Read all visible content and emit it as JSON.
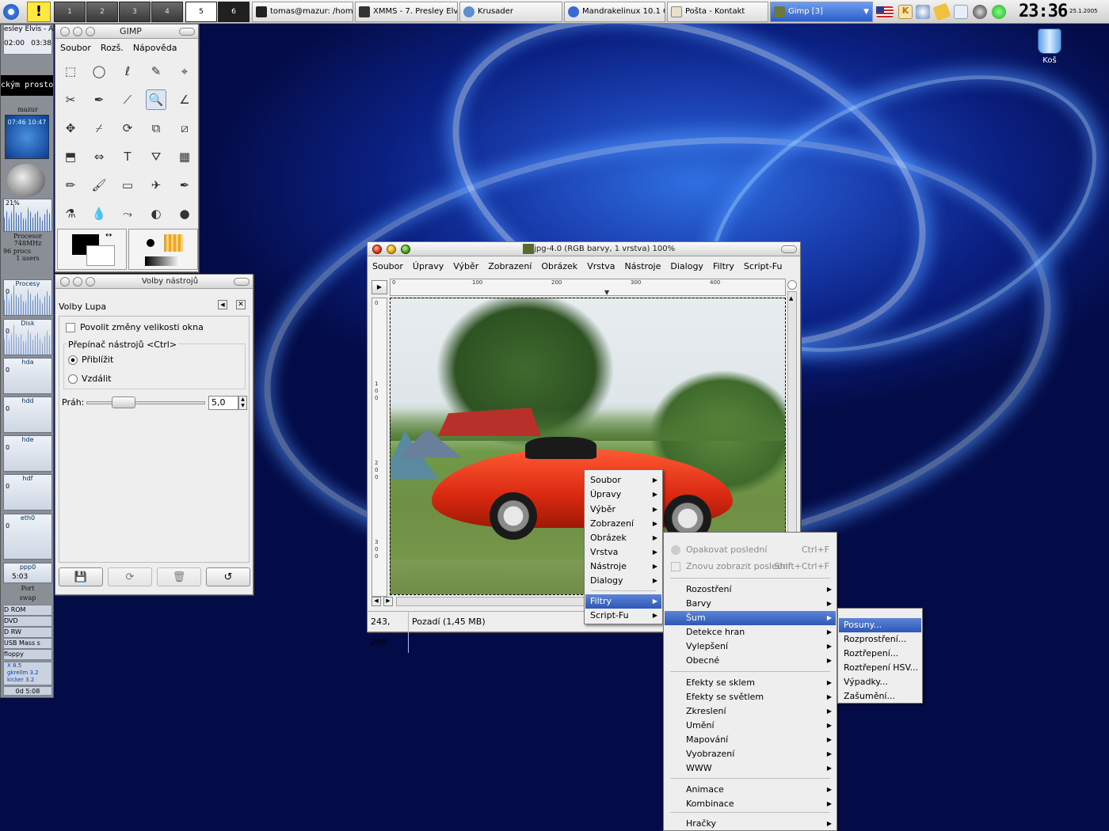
{
  "taskbar": {
    "pagers": [
      "1",
      "2",
      "3",
      "4",
      "5",
      "6"
    ],
    "tasks": [
      "tomas@mazur: /home",
      "XMMS - 7. Presley Elv",
      "Krusader",
      "Mandrakelinux 10.1 C",
      "Pošta - Kontakt",
      "Gimp [3]"
    ],
    "clock": "23:36",
    "date": "25.1.2005",
    "colors": {
      "active_task": "#2c5dc8",
      "desktop": "#0a1f80"
    }
  },
  "gkrellm": {
    "song": "esley Elvis - A",
    "time_start": "02:00",
    "time_end": "03:38",
    "marquee": "ckým prosto",
    "host": "mazur",
    "clock_face": "07:46 10:47",
    "cpu_pct": "21%",
    "cpu_label": "Procesor",
    "cpu_freq": "748MHz",
    "procs": "96 procs",
    "users": "1 users",
    "panels": [
      {
        "label": "Procesy",
        "value": "0"
      },
      {
        "label": "Disk",
        "value": "0"
      },
      {
        "label": "hda",
        "value": "0"
      },
      {
        "label": "hdd",
        "value": "0"
      },
      {
        "label": "hde",
        "value": "0"
      },
      {
        "label": "hdf",
        "value": "0"
      },
      {
        "label": "eth0",
        "value": "0"
      },
      {
        "label": "ppp0",
        "value": ""
      }
    ],
    "ppp_time": "5:03",
    "port_label": "Port",
    "swap_label": "swap",
    "mounts": [
      "D ROM",
      "DVD",
      "D RW",
      "USB Mass s",
      "floppy"
    ],
    "versions": [
      "X 8.5",
      "gkrellm 3.2",
      "kicker 3.2"
    ],
    "uptime": "0d 5:08"
  },
  "desktop": {
    "trash_label": "Koš"
  },
  "toolbox": {
    "title": "GIMP",
    "menu": [
      "Soubor",
      "Rozš.",
      "Nápověda"
    ],
    "tools": [
      "rect-select",
      "ellipse-select",
      "free-select",
      "fuzzy-select",
      "color-select",
      "scissors",
      "paths",
      "color-picker",
      "magnify",
      "measure",
      "move",
      "crop",
      "rotate",
      "scale",
      "shear",
      "perspective",
      "flip",
      "text",
      "bucket-fill",
      "blend",
      "pencil",
      "paintbrush",
      "eraser",
      "airbrush",
      "ink",
      "clone",
      "smudge-convolve",
      "dodge-burn",
      "smudge",
      "dodge"
    ]
  },
  "tool_options": {
    "title": "Volby nástrojů",
    "heading": "Volby Lupa",
    "allow_resize": "Povolit změny velikosti okna",
    "toggle_label": "Přepínač nástrojů  <Ctrl>",
    "zoom_in": "Přiblížit",
    "zoom_out": "Vzdálit",
    "threshold_label": "Práh:",
    "threshold_value": "5,0",
    "selected_mode": "Přiblížit"
  },
  "image_window": {
    "title": "l5.jpg-4.0 (RGB barvy, 1 vrstva) 100%",
    "menu": [
      "Soubor",
      "Úpravy",
      "Výběr",
      "Zobrazení",
      "Obrázek",
      "Vrstva",
      "Nástroje",
      "Dialogy",
      "Filtry",
      "Script-Fu"
    ],
    "ruler_h": [
      "0",
      "100",
      "200",
      "300",
      "400"
    ],
    "ruler_v": [
      "0",
      "1\n0\n0",
      "2\n0\n0",
      "3\n0\n0"
    ],
    "coords": "243, 206",
    "layer_info": "Pozadí (1,45 MB)"
  },
  "context_menu": {
    "items": [
      "Soubor",
      "Úpravy",
      "Výběr",
      "Zobrazení",
      "Obrázek",
      "Vrstva",
      "Nástroje",
      "Dialogy",
      "Filtry",
      "Script-Fu"
    ],
    "selected": "Filtry"
  },
  "filters_menu": {
    "repeat": {
      "label": "Opakovat poslední",
      "accel": "Ctrl+F"
    },
    "reshow": {
      "label": "Znovu zobrazit poslední",
      "accel": "Shift+Ctrl+F"
    },
    "group1": [
      "Rozostření",
      "Barvy",
      "Šum",
      "Detekce hran",
      "Vylepšení",
      "Obecné"
    ],
    "group2": [
      "Efekty se sklem",
      "Efekty se světlem",
      "Zkreslení",
      "Umění",
      "Mapování",
      "Vyobrazení",
      "WWW"
    ],
    "group3": [
      "Animace",
      "Kombinace"
    ],
    "group4": [
      "Hračky"
    ],
    "selected": "Šum"
  },
  "noise_menu": {
    "items": [
      "Posuny...",
      "Rozprostření...",
      "Roztřepení...",
      "Roztřepení HSV...",
      "Výpadky...",
      "Zašumění..."
    ],
    "selected": "Posuny..."
  }
}
